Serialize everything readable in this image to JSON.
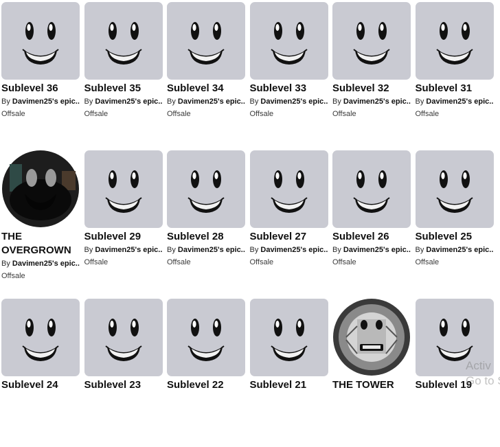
{
  "items": [
    {
      "name": "Sublevel 36",
      "by": "By ",
      "creator": "Davimen25's epic...",
      "status": "Offsale",
      "thumb": "smile"
    },
    {
      "name": "Sublevel 35",
      "by": "By ",
      "creator": "Davimen25's epic...",
      "status": "Offsale",
      "thumb": "smile"
    },
    {
      "name": "Sublevel 34",
      "by": "By ",
      "creator": "Davimen25's epic...",
      "status": "Offsale",
      "thumb": "smile"
    },
    {
      "name": "Sublevel 33",
      "by": "By ",
      "creator": "Davimen25's epic...",
      "status": "Offsale",
      "thumb": "smile"
    },
    {
      "name": "Sublevel 32",
      "by": "By ",
      "creator": "Davimen25's epic...",
      "status": "Offsale",
      "thumb": "smile"
    },
    {
      "name": "Sublevel 31",
      "by": "By ",
      "creator": "Davimen25's epic...",
      "status": "Offsale",
      "thumb": "smile"
    },
    {
      "name": "THE OVERGROWN",
      "by": "By ",
      "creator": "Davimen25's epic...",
      "status": "Offsale",
      "thumb": "overgrown"
    },
    {
      "name": "Sublevel 29",
      "by": "By ",
      "creator": "Davimen25's epic...",
      "status": "Offsale",
      "thumb": "smile"
    },
    {
      "name": "Sublevel 28",
      "by": "By ",
      "creator": "Davimen25's epic...",
      "status": "Offsale",
      "thumb": "smile"
    },
    {
      "name": "Sublevel 27",
      "by": "By ",
      "creator": "Davimen25's epic...",
      "status": "Offsale",
      "thumb": "smile"
    },
    {
      "name": "Sublevel 26",
      "by": "By ",
      "creator": "Davimen25's epic...",
      "status": "Offsale",
      "thumb": "smile"
    },
    {
      "name": "Sublevel 25",
      "by": "By ",
      "creator": "Davimen25's epic...",
      "status": "Offsale",
      "thumb": "smile"
    },
    {
      "name": "Sublevel 24",
      "thumb": "smile"
    },
    {
      "name": "Sublevel 23",
      "thumb": "smile"
    },
    {
      "name": "Sublevel 22",
      "thumb": "smile"
    },
    {
      "name": "Sublevel 21",
      "thumb": "smile"
    },
    {
      "name": "THE TOWER",
      "thumb": "tower"
    },
    {
      "name": "Sublevel 19",
      "thumb": "smile"
    }
  ],
  "watermark": {
    "line1": "Activ",
    "line2": "Go to S"
  },
  "colors": {
    "thumb_bg": "#c9cad2",
    "text": "#111111"
  }
}
